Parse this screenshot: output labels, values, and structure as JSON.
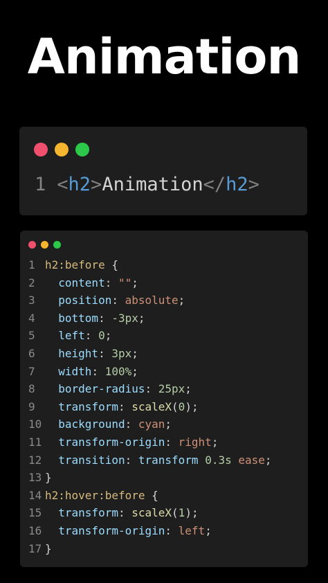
{
  "title": "Animation",
  "html_window": {
    "line_number": "1",
    "open_tag": "h2",
    "text": "Animation",
    "close_tag": "h2"
  },
  "css_window": {
    "lines": [
      {
        "n": "1",
        "parts": [
          [
            "sel",
            "h2:before"
          ],
          [
            "brace",
            " {"
          ]
        ]
      },
      {
        "n": "2",
        "parts": [
          [
            "ind",
            "  "
          ],
          [
            "prop",
            "content"
          ],
          [
            "colon",
            ": "
          ],
          [
            "val",
            "\"\""
          ],
          [
            "colon",
            ";"
          ]
        ]
      },
      {
        "n": "3",
        "parts": [
          [
            "ind",
            "  "
          ],
          [
            "prop",
            "position"
          ],
          [
            "colon",
            ": "
          ],
          [
            "val",
            "absolute"
          ],
          [
            "colon",
            ";"
          ]
        ]
      },
      {
        "n": "4",
        "parts": [
          [
            "ind",
            "  "
          ],
          [
            "prop",
            "bottom"
          ],
          [
            "colon",
            ": "
          ],
          [
            "num",
            "-3px"
          ],
          [
            "colon",
            ";"
          ]
        ]
      },
      {
        "n": "5",
        "parts": [
          [
            "ind",
            "  "
          ],
          [
            "prop",
            "left"
          ],
          [
            "colon",
            ": "
          ],
          [
            "num",
            "0"
          ],
          [
            "colon",
            ";"
          ]
        ]
      },
      {
        "n": "6",
        "parts": [
          [
            "ind",
            "  "
          ],
          [
            "prop",
            "height"
          ],
          [
            "colon",
            ": "
          ],
          [
            "num",
            "3px"
          ],
          [
            "colon",
            ";"
          ]
        ]
      },
      {
        "n": "7",
        "parts": [
          [
            "ind",
            "  "
          ],
          [
            "prop",
            "width"
          ],
          [
            "colon",
            ": "
          ],
          [
            "num",
            "100%"
          ],
          [
            "colon",
            ";"
          ]
        ]
      },
      {
        "n": "8",
        "parts": [
          [
            "ind",
            "  "
          ],
          [
            "prop",
            "border-radius"
          ],
          [
            "colon",
            ": "
          ],
          [
            "num",
            "25px"
          ],
          [
            "colon",
            ";"
          ]
        ]
      },
      {
        "n": "9",
        "parts": [
          [
            "ind",
            "  "
          ],
          [
            "prop",
            "transform"
          ],
          [
            "colon",
            ": "
          ],
          [
            "fn",
            "scaleX"
          ],
          [
            "colon",
            "("
          ],
          [
            "num",
            "0"
          ],
          [
            "colon",
            ");"
          ]
        ]
      },
      {
        "n": "10",
        "parts": [
          [
            "ind",
            "  "
          ],
          [
            "prop",
            "background"
          ],
          [
            "colon",
            ": "
          ],
          [
            "val",
            "cyan"
          ],
          [
            "colon",
            ";"
          ]
        ]
      },
      {
        "n": "11",
        "parts": [
          [
            "ind",
            "  "
          ],
          [
            "prop",
            "transform-origin"
          ],
          [
            "colon",
            ": "
          ],
          [
            "val",
            "right"
          ],
          [
            "colon",
            ";"
          ]
        ]
      },
      {
        "n": "12",
        "parts": [
          [
            "ind",
            "  "
          ],
          [
            "prop",
            "transition"
          ],
          [
            "colon",
            ": "
          ],
          [
            "prop",
            "transform "
          ],
          [
            "num",
            "0.3s "
          ],
          [
            "val",
            "ease"
          ],
          [
            "colon",
            ";"
          ]
        ]
      },
      {
        "n": "13",
        "parts": [
          [
            "brace",
            "}"
          ]
        ]
      },
      {
        "n": "14",
        "parts": [
          [
            "sel",
            "h2:hover:before"
          ],
          [
            "brace",
            " {"
          ]
        ]
      },
      {
        "n": "15",
        "parts": [
          [
            "ind",
            "  "
          ],
          [
            "prop",
            "transform"
          ],
          [
            "colon",
            ": "
          ],
          [
            "fn",
            "scaleX"
          ],
          [
            "colon",
            "("
          ],
          [
            "num",
            "1"
          ],
          [
            "colon",
            ");"
          ]
        ]
      },
      {
        "n": "16",
        "parts": [
          [
            "ind",
            "  "
          ],
          [
            "prop",
            "transform-origin"
          ],
          [
            "colon",
            ": "
          ],
          [
            "val",
            "left"
          ],
          [
            "colon",
            ";"
          ]
        ]
      },
      {
        "n": "17",
        "parts": [
          [
            "brace",
            "}"
          ]
        ]
      }
    ]
  },
  "colors": {
    "background": "#000000",
    "window_bg": "#1e1e1e",
    "dot_red": "#f0506e",
    "dot_yellow": "#f5b52e",
    "dot_green": "#2bc84a",
    "tag": "#569cd6",
    "selector": "#d7ba7d",
    "property": "#9cdcfe",
    "string_value": "#ce9178",
    "number": "#b5cea8",
    "function": "#dcdcaa"
  }
}
